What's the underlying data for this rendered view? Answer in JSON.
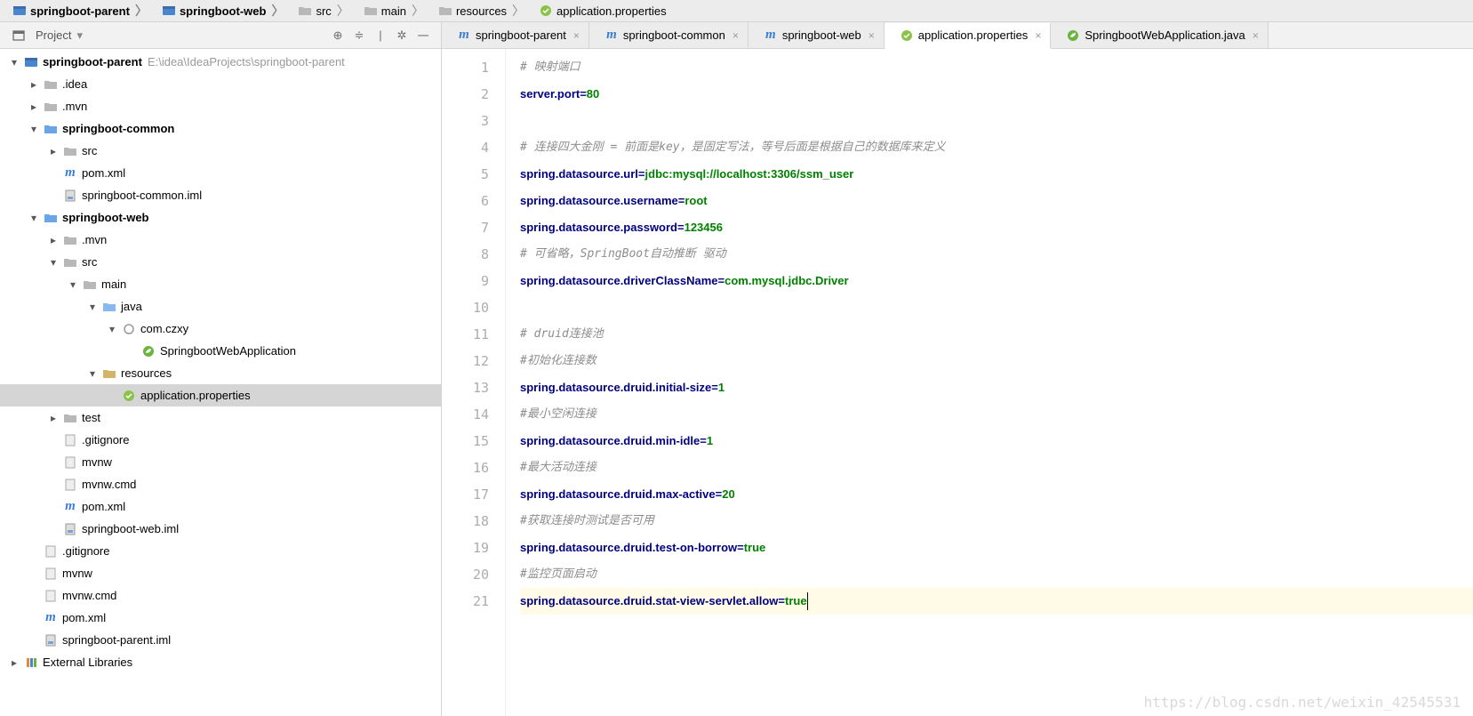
{
  "breadcrumb": [
    {
      "label": "springboot-parent",
      "icon": "module"
    },
    {
      "label": "springboot-web",
      "icon": "module"
    },
    {
      "label": "src",
      "icon": "folder"
    },
    {
      "label": "main",
      "icon": "folder"
    },
    {
      "label": "resources",
      "icon": "folder"
    },
    {
      "label": "application.properties",
      "icon": "prop"
    }
  ],
  "panel": {
    "title": "Project",
    "dropdown": "▾"
  },
  "tree": [
    {
      "d": 0,
      "tw": "▾",
      "icon": "module",
      "label": "springboot-parent",
      "bold": true,
      "hint": "E:\\idea\\IdeaProjects\\springboot-parent"
    },
    {
      "d": 1,
      "tw": "▸",
      "icon": "folder-dim",
      "label": ".idea"
    },
    {
      "d": 1,
      "tw": "▸",
      "icon": "folder-dim",
      "label": ".mvn"
    },
    {
      "d": 1,
      "tw": "▾",
      "icon": "folder-mod",
      "label": "springboot-common",
      "bold": true
    },
    {
      "d": 2,
      "tw": "▸",
      "icon": "folder-dim",
      "label": "src"
    },
    {
      "d": 2,
      "tw": "",
      "icon": "maven",
      "label": "pom.xml"
    },
    {
      "d": 2,
      "tw": "",
      "icon": "iml",
      "label": "springboot-common.iml"
    },
    {
      "d": 1,
      "tw": "▾",
      "icon": "folder-mod",
      "label": "springboot-web",
      "bold": true
    },
    {
      "d": 2,
      "tw": "▸",
      "icon": "folder-dim",
      "label": ".mvn"
    },
    {
      "d": 2,
      "tw": "▾",
      "icon": "folder-dim",
      "label": "src"
    },
    {
      "d": 3,
      "tw": "▾",
      "icon": "folder-dim",
      "label": "main"
    },
    {
      "d": 4,
      "tw": "▾",
      "icon": "folder-src",
      "label": "java"
    },
    {
      "d": 5,
      "tw": "▾",
      "icon": "package",
      "label": "com.czxy"
    },
    {
      "d": 6,
      "tw": "",
      "icon": "spring",
      "label": "SpringbootWebApplication"
    },
    {
      "d": 4,
      "tw": "▾",
      "icon": "folder-res",
      "label": "resources"
    },
    {
      "d": 5,
      "tw": "",
      "icon": "prop",
      "label": "application.properties",
      "selected": true
    },
    {
      "d": 2,
      "tw": "▸",
      "icon": "folder-dim",
      "label": "test"
    },
    {
      "d": 2,
      "tw": "",
      "icon": "file",
      "label": ".gitignore"
    },
    {
      "d": 2,
      "tw": "",
      "icon": "file",
      "label": "mvnw"
    },
    {
      "d": 2,
      "tw": "",
      "icon": "file",
      "label": "mvnw.cmd"
    },
    {
      "d": 2,
      "tw": "",
      "icon": "maven",
      "label": "pom.xml"
    },
    {
      "d": 2,
      "tw": "",
      "icon": "iml",
      "label": "springboot-web.iml"
    },
    {
      "d": 1,
      "tw": "",
      "icon": "file",
      "label": ".gitignore"
    },
    {
      "d": 1,
      "tw": "",
      "icon": "file",
      "label": "mvnw"
    },
    {
      "d": 1,
      "tw": "",
      "icon": "file",
      "label": "mvnw.cmd"
    },
    {
      "d": 1,
      "tw": "",
      "icon": "maven",
      "label": "pom.xml"
    },
    {
      "d": 1,
      "tw": "",
      "icon": "iml",
      "label": "springboot-parent.iml"
    },
    {
      "d": 0,
      "tw": "▸",
      "icon": "lib",
      "label": "External Libraries"
    }
  ],
  "tabs": [
    {
      "icon": "maven",
      "label": "springboot-parent"
    },
    {
      "icon": "maven",
      "label": "springboot-common"
    },
    {
      "icon": "maven",
      "label": "springboot-web"
    },
    {
      "icon": "prop",
      "label": "application.properties",
      "active": true
    },
    {
      "icon": "spring",
      "label": "SpringbootWebApplication.java"
    }
  ],
  "code": [
    {
      "n": 1,
      "type": "comment",
      "text": "# 映射端口"
    },
    {
      "n": 2,
      "type": "prop",
      "key": "server.port",
      "val": "80"
    },
    {
      "n": 3,
      "type": "blank"
    },
    {
      "n": 4,
      "type": "comment",
      "text": "# 连接四大金刚 = 前面是key，是固定写法，等号后面是根据自己的数据库来定义"
    },
    {
      "n": 5,
      "type": "prop",
      "key": "spring.datasource.url",
      "val": "jdbc:mysql://localhost:3306/ssm_user"
    },
    {
      "n": 6,
      "type": "prop",
      "key": "spring.datasource.username",
      "val": "root"
    },
    {
      "n": 7,
      "type": "prop",
      "key": "spring.datasource.password",
      "val": "123456"
    },
    {
      "n": 8,
      "type": "comment",
      "text": "# 可省略，SpringBoot自动推断 驱动"
    },
    {
      "n": 9,
      "type": "prop",
      "key": "spring.datasource.driverClassName",
      "val": "com.mysql.jdbc.Driver"
    },
    {
      "n": 10,
      "type": "blank"
    },
    {
      "n": 11,
      "type": "comment",
      "text": "# druid连接池"
    },
    {
      "n": 12,
      "type": "comment",
      "text": "#初始化连接数"
    },
    {
      "n": 13,
      "type": "prop",
      "key": "spring.datasource.druid.initial-size",
      "val": "1"
    },
    {
      "n": 14,
      "type": "comment",
      "text": "#最小空闲连接"
    },
    {
      "n": 15,
      "type": "prop",
      "key": "spring.datasource.druid.min-idle",
      "val": "1"
    },
    {
      "n": 16,
      "type": "comment",
      "text": "#最大活动连接"
    },
    {
      "n": 17,
      "type": "prop",
      "key": "spring.datasource.druid.max-active",
      "val": "20"
    },
    {
      "n": 18,
      "type": "comment",
      "text": "#获取连接时测试是否可用"
    },
    {
      "n": 19,
      "type": "prop",
      "key": "spring.datasource.druid.test-on-borrow",
      "val": "true"
    },
    {
      "n": 20,
      "type": "comment",
      "text": "#监控页面启动"
    },
    {
      "n": 21,
      "type": "prop",
      "key": "spring.datasource.druid.stat-view-servlet.allow",
      "val": "true",
      "caret": true,
      "hl": true
    }
  ],
  "watermark": "https://blog.csdn.net/weixin_42545531"
}
